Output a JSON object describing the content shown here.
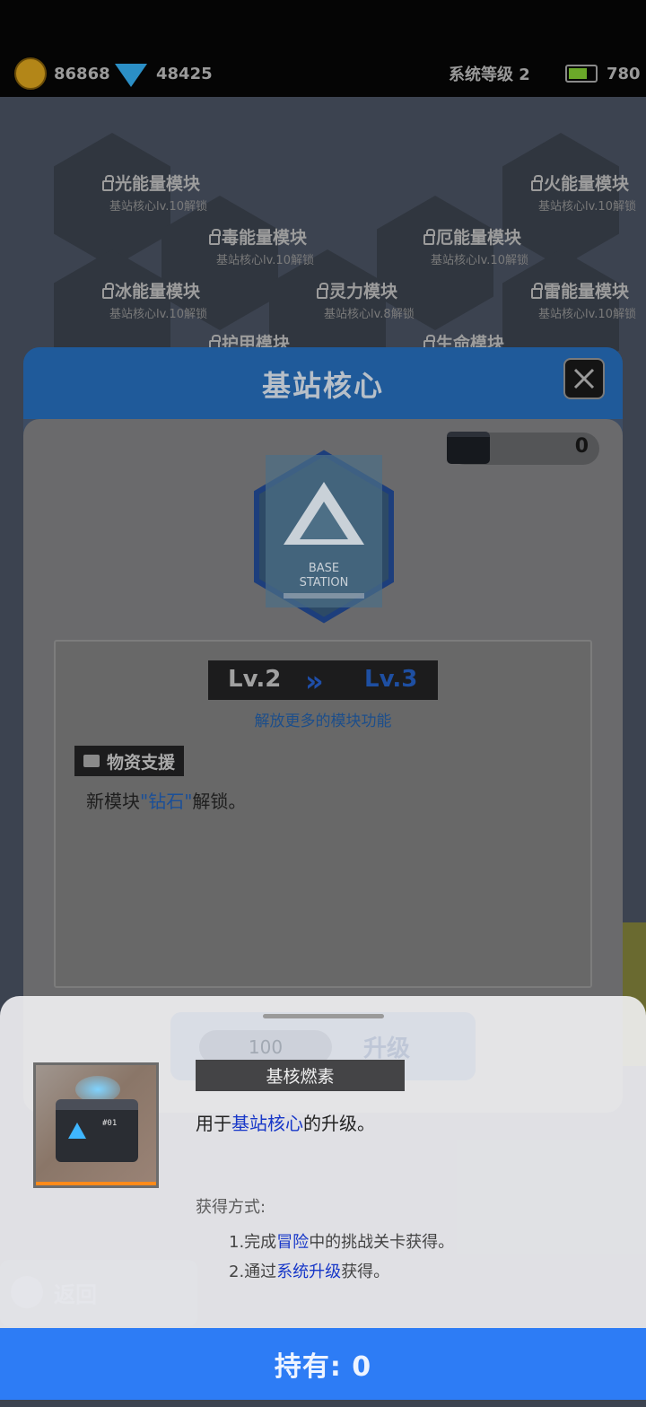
{
  "resources": {
    "gold": "86868",
    "diamond": "48425",
    "system_level": "系统等级 2",
    "energy": "780"
  },
  "modules": [
    {
      "name": "光能量模块",
      "unlock": "基站核心lv.10解锁"
    },
    {
      "name": "火能量模块",
      "unlock": "基站核心lv.10解锁"
    },
    {
      "name": "毒能量模块",
      "unlock": "基站核心lv.10解锁"
    },
    {
      "name": "厄能量模块",
      "unlock": "基站核心lv.10解锁"
    },
    {
      "name": "冰能量模块",
      "unlock": "基站核心lv.10解锁"
    },
    {
      "name": "灵力模块",
      "unlock": "基站核心lv.8解锁"
    },
    {
      "name": "雷能量模块",
      "unlock": "基站核心lv.10解锁"
    },
    {
      "name": "护甲模块",
      "unlock": ""
    },
    {
      "name": "生命模块",
      "unlock": ""
    }
  ],
  "dialog": {
    "title": "基站核心",
    "material_count": "0",
    "emblem_text_line1": "BASE",
    "emblem_text_line2": "STATION",
    "level_from": "Lv.2",
    "level_to": "Lv.3",
    "level_arrow": "»",
    "unlock_text": "解放更多的模块功能",
    "tag_label": "物资支援",
    "tag_desc_prefix": "新模块",
    "tag_desc_highlight": "\"钻石\"",
    "tag_desc_suffix": "解锁。",
    "upgrade_cost": "100",
    "upgrade_label": "升级"
  },
  "item_sheet": {
    "item_name": "基核燃素",
    "item_code": "#01",
    "use_prefix": "用于",
    "use_highlight": "基站核心",
    "use_suffix": "的升级。",
    "acquire_title": "获得方式:",
    "acquire": [
      {
        "prefix": "1.完成",
        "highlight": "冒险",
        "suffix": "中的挑战关卡获得。"
      },
      {
        "prefix": "2.通过",
        "highlight": "系统升级",
        "suffix": "获得。"
      }
    ],
    "hold_label": "持有: 0",
    "back_label": "返回"
  },
  "colors": {
    "accent_blue": "#2d7cf5",
    "highlight_blue": "#1737c8",
    "dialog_header": "#1f5a9a",
    "rarity_orange": "#ff8a1a"
  }
}
